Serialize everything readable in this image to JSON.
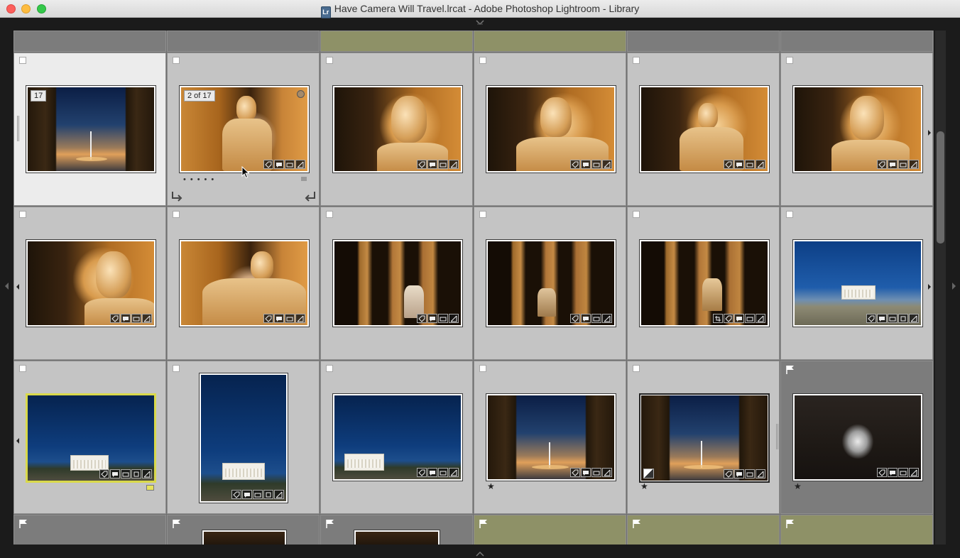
{
  "window": {
    "title": "Have Camera Will Travel.lrcat - Adobe Photoshop Lightroom - Library"
  },
  "grid": {
    "stack_index_label": "17",
    "stack_position_label": "2 of 17",
    "rows": [
      {
        "cells": [
          {
            "image": "columns-dawn"
          },
          {
            "image": "warm-wide"
          },
          {
            "image": "warm"
          },
          {
            "image": "warm"
          },
          {
            "image": "warm"
          },
          {
            "image": "warm"
          }
        ]
      },
      {
        "cells": [
          {
            "image": "warm"
          },
          {
            "image": "warm-wide"
          },
          {
            "image": "hall"
          },
          {
            "image": "hall"
          },
          {
            "image": "hall"
          },
          {
            "image": "blue-day"
          }
        ]
      },
      {
        "cells": [
          {
            "image": "blue-night",
            "color_label": "yellow"
          },
          {
            "image": "blue-night",
            "orientation": "portrait"
          },
          {
            "image": "blue-night"
          },
          {
            "image": "columns-dawn",
            "rating": 1
          },
          {
            "image": "columns-dawn",
            "rating": 1
          },
          {
            "image": "dark-statue",
            "rating": 1
          }
        ]
      }
    ],
    "rating_star": "★",
    "colors": {
      "cell_background": "#c4c4c4",
      "selected_cell": "#ececec",
      "unselected_dark_cell": "#7c7c7c",
      "olive_cell": "#8e9167",
      "active_border": "#d9d94a",
      "color_label_yellow": "#e6e35c"
    }
  },
  "badges": [
    "keyword-badge",
    "comment-badge",
    "collection-badge",
    "crop-badge",
    "develop-adjust-badge"
  ]
}
